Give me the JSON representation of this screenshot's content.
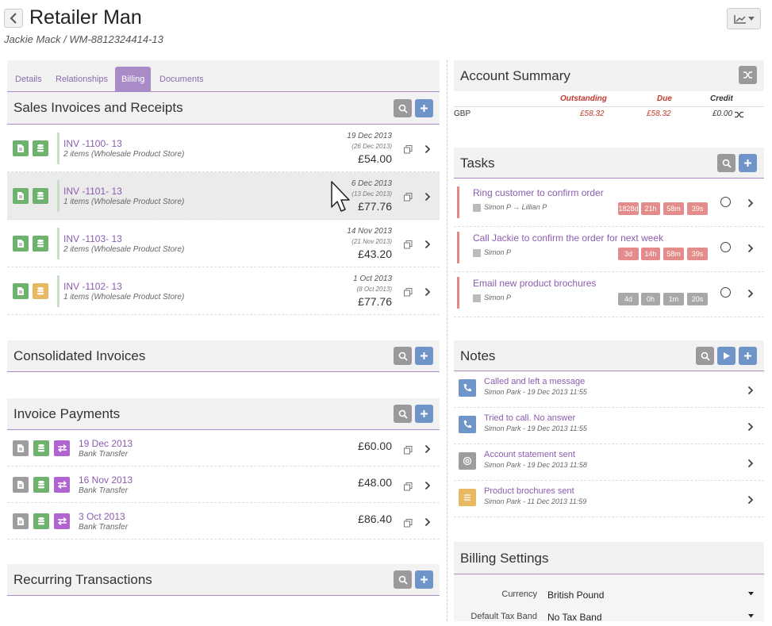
{
  "header": {
    "title": "Retailer Man",
    "subtitle": "Jackie Mack / WM-8812324414-13"
  },
  "tabs": [
    {
      "label": "Details"
    },
    {
      "label": "Relationships"
    },
    {
      "label": "Billing"
    },
    {
      "label": "Documents"
    }
  ],
  "sales": {
    "title": "Sales Invoices and Receipts",
    "rows": [
      {
        "inv": "INV -1100- 13",
        "items": "2 items (Wholesale Product Store)",
        "date": "19 Dec 2013",
        "due": "(26 Dec 2013)",
        "amount": "£54.00"
      },
      {
        "inv": "INV -1101- 13",
        "items": "1 items (Wholesale Product Store)",
        "date": "6 Dec 2013",
        "due": "(13 Dec 2013)",
        "amount": "£77.76"
      },
      {
        "inv": "INV -1103- 13",
        "items": "2 items (Wholesale Product Store)",
        "date": "14 Nov 2013",
        "due": "(21 Nov 2013)",
        "amount": "£43.20"
      },
      {
        "inv": "INV -1102- 13",
        "items": "1 items (Wholesale Product Store)",
        "date": "1 Oct 2013",
        "due": "(8 Oct 2013)",
        "amount": "£77.76"
      }
    ]
  },
  "consolidated": {
    "title": "Consolidated Invoices"
  },
  "payments": {
    "title": "Invoice Payments",
    "rows": [
      {
        "date": "19 Dec 2013",
        "method": "Bank Transfer",
        "amount": "£60.00"
      },
      {
        "date": "16 Nov 2013",
        "method": "Bank Transfer",
        "amount": "£48.00"
      },
      {
        "date": "3 Oct 2013",
        "method": "Bank Transfer",
        "amount": "£86.40"
      }
    ]
  },
  "recurring": {
    "title": "Recurring Transactions"
  },
  "summary": {
    "title": "Account Summary",
    "headers": {
      "outstanding": "Outstanding",
      "due": "Due",
      "credit": "Credit"
    },
    "currency": "GBP",
    "outstanding": "£58.32",
    "due": "£58.32",
    "credit": "£0.00"
  },
  "tasks": {
    "title": "Tasks",
    "rows": [
      {
        "title": "Ring customer to confirm order",
        "who": "Simon P → Lillian P",
        "timers": [
          "1828d",
          "21h",
          "58m",
          "39s"
        ],
        "overdue": true
      },
      {
        "title": "Call Jackie to confirm the order for next week",
        "who": "Simon P",
        "timers": [
          "3d",
          "14h",
          "58m",
          "39s"
        ],
        "overdue": true
      },
      {
        "title": "Email new product brochures",
        "who": "Simon P",
        "timers": [
          "4d",
          "0h",
          "1m",
          "20s"
        ],
        "overdue": false
      }
    ]
  },
  "notes": {
    "title": "Notes",
    "rows": [
      {
        "icon": "phone-icon",
        "text": "Called and left a message",
        "meta": "Simon Park - 19 Dec 2013 11:55"
      },
      {
        "icon": "phone-icon",
        "text": "Tried to call. No answer",
        "meta": "Simon Park - 19 Dec 2013 11:55"
      },
      {
        "icon": "at-icon",
        "text": "Account statement sent",
        "meta": "Simon Park - 19 Dec 2013 11:58"
      },
      {
        "icon": "note-icon",
        "text": "Product brochures sent",
        "meta": "Simon Park - 11 Dec 2013 11:59"
      }
    ]
  },
  "billing": {
    "title": "Billing Settings",
    "currency_label": "Currency",
    "currency_value": "British Pound",
    "taxband_label": "Default Tax Band",
    "taxband_value": "No Tax Band"
  },
  "colors": {
    "accent": "#a98bc8",
    "link": "#8a5cae",
    "green": "#6db36d",
    "blue": "#6f95c8",
    "overdue": "#e48b8b"
  }
}
